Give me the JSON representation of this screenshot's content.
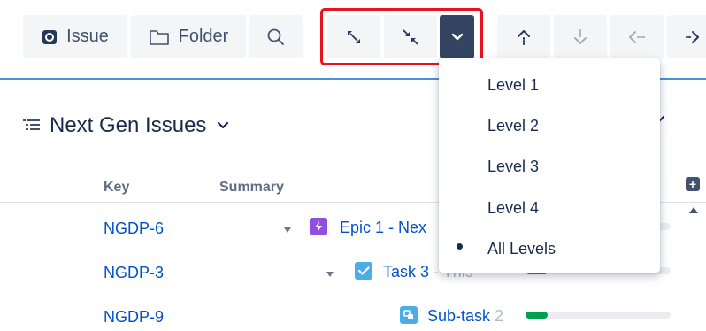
{
  "toolbar": {
    "issue_label": "Issue",
    "folder_label": "Folder"
  },
  "title": {
    "text": "Next Gen Issues"
  },
  "table": {
    "columns": [
      "Key",
      "Summary"
    ],
    "rows": [
      {
        "key": "NGDP-6",
        "type": "epic",
        "summary": "Epic 1 - Nex",
        "summary_hidden": "",
        "progress": 0.0
      },
      {
        "key": "NGDP-3",
        "type": "task",
        "summary": "Task 3",
        "summary_hidden": " - This",
        "progress": 0.15
      },
      {
        "key": "NGDP-9",
        "type": "subtask",
        "summary": "Sub-task",
        "summary_hidden": " 2",
        "progress": 0.15
      }
    ]
  },
  "dropdown": {
    "items": [
      "Level 1",
      "Level 2",
      "Level 3",
      "Level 4",
      "All Levels"
    ],
    "selected": "All Levels"
  },
  "colors": {
    "highlight": "#e5141e",
    "accent_line": "#4a90d9",
    "link": "#0052cc",
    "epic": "#904ee2",
    "task": "#4bade8",
    "progress": "#00a04f"
  }
}
